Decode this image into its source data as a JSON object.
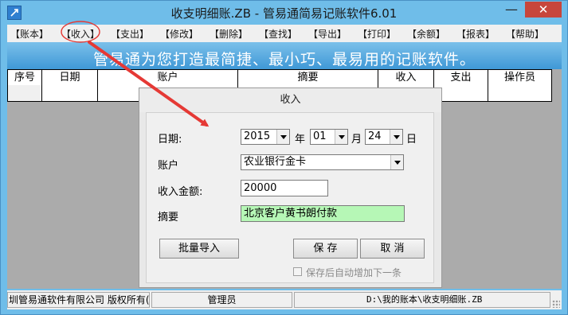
{
  "window": {
    "title": "收支明细账.ZB - 管易通简易记账软件6.01",
    "close_label": "✕",
    "minimize_label": "—"
  },
  "menu": {
    "items": [
      {
        "label": "【账本】"
      },
      {
        "label": "【收入】"
      },
      {
        "label": "【支出】"
      },
      {
        "label": "【修改】"
      },
      {
        "label": "【删除】"
      },
      {
        "label": "【查找】"
      },
      {
        "label": "【导出】"
      },
      {
        "label": "【打印】"
      },
      {
        "label": "【余额】"
      },
      {
        "label": "【报表】"
      },
      {
        "label": "【帮助】"
      }
    ]
  },
  "banner": {
    "text": "管易通为您打造最简捷、最小巧、最易用的记账软件。"
  },
  "grid": {
    "columns": [
      "序号",
      "日期",
      "账户",
      "摘要",
      "收入",
      "支出",
      "操作员"
    ]
  },
  "dialog": {
    "title": "收入",
    "date_label": "日期:",
    "year_value": "2015",
    "year_unit": "年",
    "month_value": "01",
    "month_unit": "月",
    "day_value": "24",
    "day_unit": "日",
    "account_label": "账户",
    "account_value": "农业银行金卡",
    "amount_label": "收入金额:",
    "amount_value": "20000",
    "memo_label": "摘要",
    "memo_value": "北京客户黄书朗付款",
    "batch_import_label": "批量导入",
    "save_label": "保  存",
    "cancel_label": "取  消",
    "auto_add_label": "保存后自动增加下一条"
  },
  "status": {
    "company": "圳管易通软件有限公司 版权所有(",
    "operator": "管理员",
    "file_path": "D:\\我的账本\\收支明细账.ZB"
  },
  "colors": {
    "window_frame": "#6fbde9",
    "banner": "#3f98d6",
    "annotation": "#e53935",
    "memo_highlight": "#b6f7b6"
  }
}
